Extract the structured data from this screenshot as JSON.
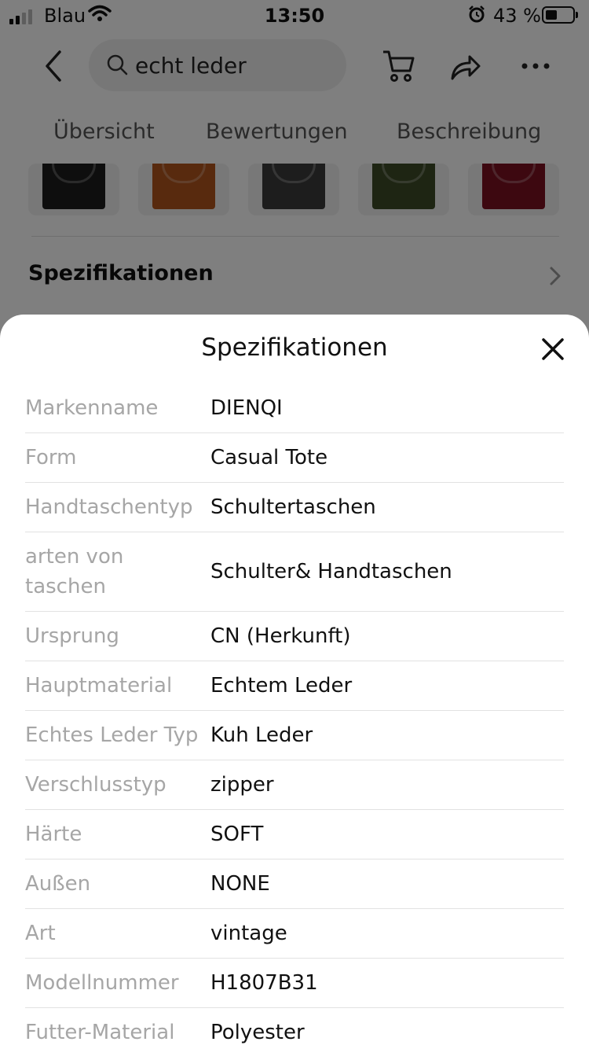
{
  "status_bar": {
    "carrier": "Blau",
    "time": "13:50",
    "battery_percent": "43 %",
    "battery_level": 0.43
  },
  "nav": {
    "search_query": "echt leder"
  },
  "tabs": [
    {
      "label": "Übersicht"
    },
    {
      "label": "Bewertungen"
    },
    {
      "label": "Beschreibung"
    }
  ],
  "thumbnails": [
    {
      "name": "bag-thumbnail-black",
      "color": "#1d1d1d"
    },
    {
      "name": "bag-thumbnail-brown",
      "color": "#b0541c"
    },
    {
      "name": "bag-thumbnail-gray",
      "color": "#3b3b3b"
    },
    {
      "name": "bag-thumbnail-green",
      "color": "#3d4a26"
    },
    {
      "name": "bag-thumbnail-red",
      "color": "#7a1020"
    }
  ],
  "background_section": {
    "heading": "Spezifikationen"
  },
  "sheet": {
    "title": "Spezifikationen",
    "rows": [
      {
        "key": "Markenname",
        "value": "DIENQI"
      },
      {
        "key": "Form",
        "value": "Casual Tote"
      },
      {
        "key": "Handtaschentyp",
        "value": "Schultertaschen"
      },
      {
        "key": "arten von taschen",
        "value": "Schulter& Handtaschen"
      },
      {
        "key": "Ursprung",
        "value": "CN (Herkunft)"
      },
      {
        "key": "Hauptmaterial",
        "value": "Echtem Leder"
      },
      {
        "key": "Echtes Leder Typ",
        "value": "Kuh Leder"
      },
      {
        "key": "Verschlusstyp",
        "value": "zipper"
      },
      {
        "key": "Härte",
        "value": "SOFT"
      },
      {
        "key": "Außen",
        "value": "NONE"
      },
      {
        "key": "Art",
        "value": "vintage"
      },
      {
        "key": "Modellnummer",
        "value": "H1807B31"
      },
      {
        "key": "Futter-Material",
        "value": "Polyester"
      }
    ]
  }
}
